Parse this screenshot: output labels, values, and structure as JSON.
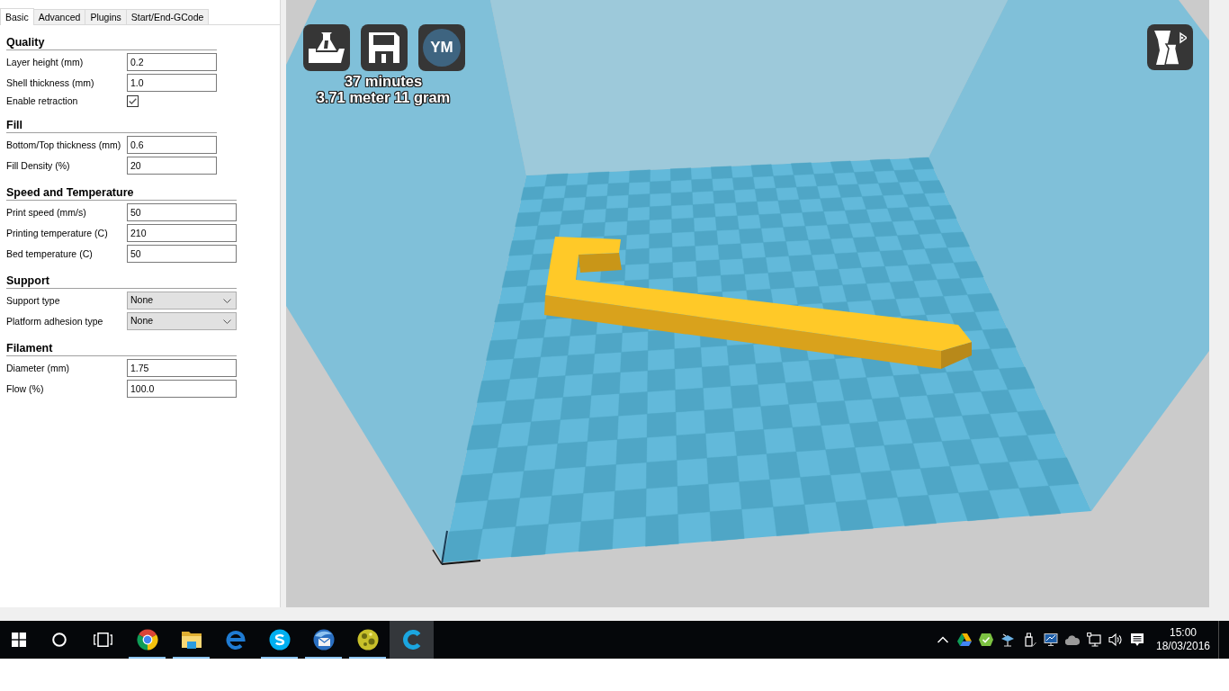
{
  "settings_panel": {
    "tabs": [
      {
        "label": "Basic",
        "selected": true
      },
      {
        "label": "Advanced",
        "selected": false
      },
      {
        "label": "Plugins",
        "selected": false
      },
      {
        "label": "Start/End-GCode",
        "selected": false
      }
    ],
    "sections": [
      {
        "title": "Quality",
        "rows": [
          {
            "kind": "text",
            "label": "Layer height (mm)",
            "value": "0.2"
          },
          {
            "kind": "text",
            "label": "Shell thickness (mm)",
            "value": "1.0"
          },
          {
            "kind": "checkbox",
            "label": "Enable retraction",
            "checked": true
          }
        ]
      },
      {
        "title": "Fill",
        "rows": [
          {
            "kind": "text",
            "label": "Bottom/Top thickness (mm)",
            "value": "0.6"
          },
          {
            "kind": "text",
            "label": "Fill Density (%)",
            "value": "20"
          }
        ]
      },
      {
        "title": "Speed and Temperature",
        "rows": [
          {
            "kind": "text",
            "label": "Print speed (mm/s)",
            "value": "50"
          },
          {
            "kind": "text",
            "label": "Printing temperature (C)",
            "value": "210"
          },
          {
            "kind": "text",
            "label": "Bed temperature (C)",
            "value": "50"
          }
        ]
      },
      {
        "title": "Support",
        "rows": [
          {
            "kind": "select",
            "label": "Support type",
            "value": "None"
          },
          {
            "kind": "select",
            "label": "Platform adhesion type",
            "value": "None"
          }
        ]
      },
      {
        "title": "Filament",
        "rows": [
          {
            "kind": "text",
            "label": "Diameter (mm)",
            "value": "1.75"
          },
          {
            "kind": "text",
            "label": "Flow (%)",
            "value": "100.0"
          }
        ]
      }
    ]
  },
  "viewport": {
    "account_button": "YM",
    "print_time": "37 minutes",
    "material_usage": "3.71 meter 11 gram"
  },
  "taskbar": {
    "apps": [
      {
        "kind": "ring",
        "running": true,
        "active": false
      },
      {
        "kind": "folder",
        "running": true,
        "active": false
      },
      {
        "kind": "e",
        "running": false,
        "active": false
      },
      {
        "kind": "s",
        "running": true,
        "active": false
      },
      {
        "kind": "mail",
        "running": true,
        "active": false
      },
      {
        "kind": "globe",
        "running": true,
        "active": false
      },
      {
        "kind": "c",
        "running": false,
        "active": true
      }
    ],
    "clock": {
      "time": "15:00",
      "date": "18/03/2016"
    }
  }
}
